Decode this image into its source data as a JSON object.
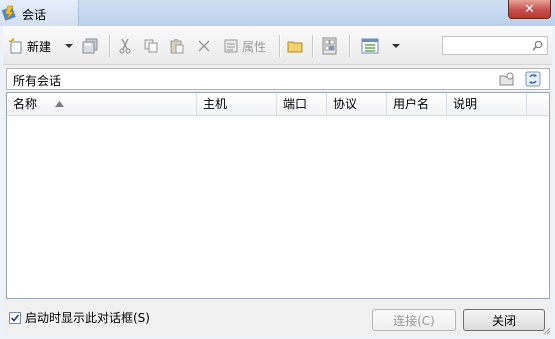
{
  "window": {
    "title": "会话",
    "close_glyph": "✕"
  },
  "toolbar": {
    "new_label": "新建",
    "properties_label": "属性",
    "search_placeholder": ""
  },
  "path_bar": {
    "label": "所有会话"
  },
  "table": {
    "columns": [
      "名称",
      "主机",
      "端口",
      "协议",
      "用户名",
      "说明"
    ],
    "sort_column": "名称",
    "rows": []
  },
  "footer": {
    "show_on_startup_label": "启动时显示此对话框(S)",
    "show_on_startup_checked": true,
    "connect_label": "连接(C)",
    "close_label": "关闭"
  }
}
